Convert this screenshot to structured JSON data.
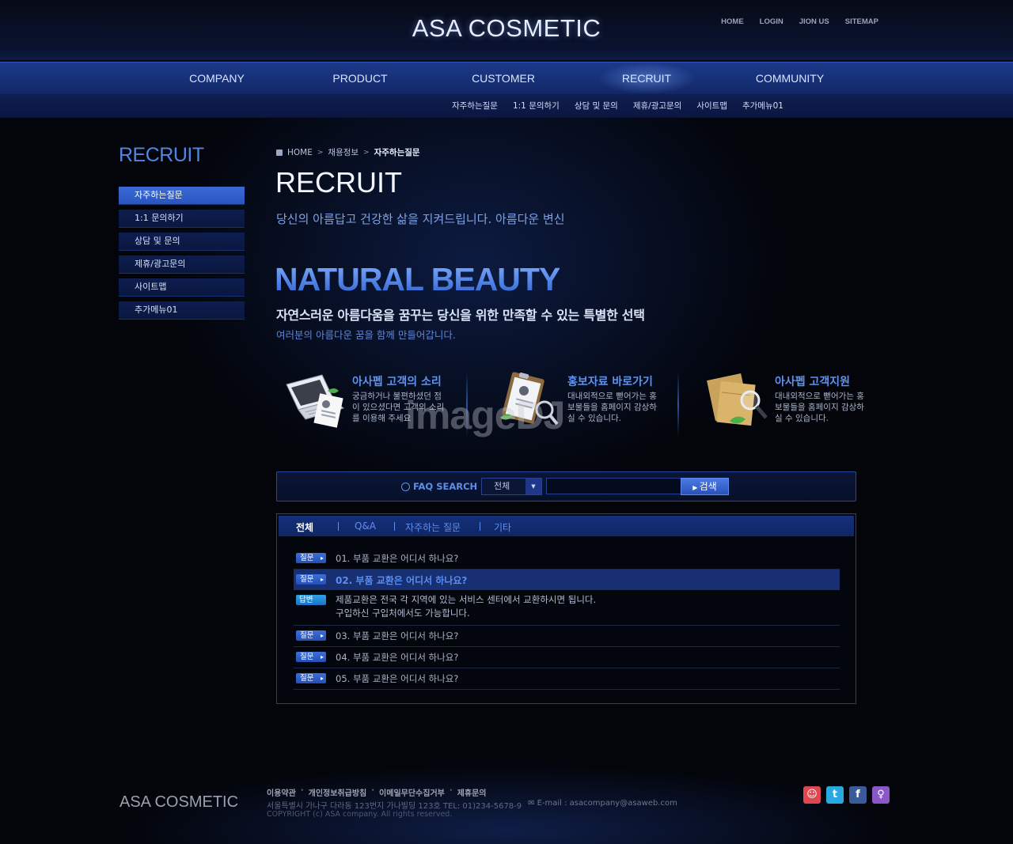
{
  "header": {
    "logo": "ASA COSMETIC",
    "util_links": [
      "HOME",
      "LOGIN",
      "JION US",
      "SITEMAP"
    ]
  },
  "gnb": {
    "items": [
      "COMPANY",
      "PRODUCT",
      "CUSTOMER",
      "RECRUIT",
      "COMMUNITY"
    ],
    "active": "RECRUIT"
  },
  "subnav": [
    "자주하는질문",
    "1:1 문의하기",
    "상담 및 문의",
    "제휴/광고문의",
    "사이트맵",
    "추가메뉴01"
  ],
  "sidebar": {
    "title": "RECRUIT",
    "items": [
      "자주하는질문",
      "1:1 문의하기",
      "상담 및 문의",
      "제휴/광고문의",
      "사이트맵",
      "추가메뉴01"
    ],
    "active_index": 0
  },
  "breadcrumb": [
    "HOME",
    "채용정보",
    "자주하는질문"
  ],
  "page": {
    "title": "RECRUIT",
    "subtitle": "당신의 아름답고 건강한 삶을 지켜드립니다. 아름다운 변신"
  },
  "hero": {
    "title": "NATURAL BEAUTY",
    "subtitle": "자연스러운 아름다움을 꿈꾸는 당신을 위한 만족할 수 있는 특별한 선택",
    "desc": "여러분의 아름다운 꿈을 함께 만들어갑니다."
  },
  "features": [
    {
      "title": "아사펩 고객의 소리",
      "text": "궁금하거나 불편하셨던 점이 있으셨다면 고객의 소리를 이용해 주세요",
      "icon": "laptop-icon"
    },
    {
      "title": "홍보자료 바로가기",
      "text": "대내외적으로 뻗어가는 홍보물들을 홈페이지 감상하실 수 있습니다.",
      "icon": "clipboard-icon"
    },
    {
      "title": "아사펩 고객지원",
      "text": "대내외적으로 뻗어가는 홍보물들을 홈페이지 감상하실 수 있습니다.",
      "icon": "envelope-magnifier-icon"
    }
  ],
  "watermark": "imageDJ",
  "search": {
    "label": "FAQ SEARCH",
    "select_value": "전체",
    "input_value": "",
    "button": "검색"
  },
  "faq": {
    "tabs": [
      "전체",
      "Q&A",
      "자주하는 질문",
      "기타"
    ],
    "active_tab": "전체",
    "question_tag": "질문",
    "answer_tag": "답변",
    "items": [
      "01. 부품 교환은 어디서 하나요?",
      "02. 부품 교환은 어디서 하나요?",
      "03. 부품 교환은 어디서 하나요?",
      "04. 부품 교환은 어디서 하나요?",
      "05. 부품 교환은 어디서 하나요?"
    ],
    "open_index": 1,
    "answer_line1": "제품교환은 전국 각 지역에 있는 서비스 센터에서 교환하시면 됩니다.",
    "answer_line2": "구입하신 구입처에서도 가능합니다."
  },
  "footer": {
    "logo": "ASA COSMETIC",
    "links": [
      "이용약관",
      "개인정보취급방침",
      "이메일무단수집거부",
      "제휴문의"
    ],
    "address": "서울특별시 가나구 다라동 123번지 가나빌딩 123호  TEL: 01)234-5678-9",
    "email": "E-mail : asacompany@asaweb.com",
    "copyright": "COPYRIGHT (c) ASA company. All rights reserved.",
    "sns": [
      {
        "name": "me2day",
        "color": "#e0464f",
        "glyph": "☺"
      },
      {
        "name": "twitter",
        "color": "#2aa9e0",
        "glyph": "t"
      },
      {
        "name": "facebook",
        "color": "#3b5a9a",
        "glyph": "f"
      },
      {
        "name": "yozm",
        "color": "#8a57c9",
        "glyph": "♀"
      }
    ]
  }
}
